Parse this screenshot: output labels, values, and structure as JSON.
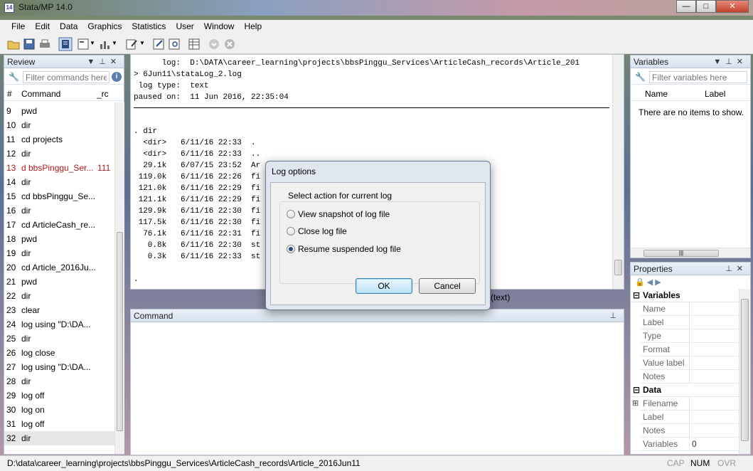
{
  "window": {
    "title": "Stata/MP 14.0",
    "app_icon_text": "14"
  },
  "menu": [
    "File",
    "Edit",
    "Data",
    "Graphics",
    "Statistics",
    "User",
    "Window",
    "Help"
  ],
  "review": {
    "title": "Review",
    "filter_placeholder": "Filter commands here",
    "columns": {
      "num": "#",
      "command": "Command",
      "rc": "_rc"
    },
    "rows": [
      {
        "num": "9",
        "cmd": "pwd",
        "rc": ""
      },
      {
        "num": "10",
        "cmd": "dir",
        "rc": ""
      },
      {
        "num": "11",
        "cmd": "cd projects",
        "rc": ""
      },
      {
        "num": "12",
        "cmd": "dir",
        "rc": ""
      },
      {
        "num": "13",
        "cmd": "d bbsPinggu_Ser...",
        "rc": "111"
      },
      {
        "num": "14",
        "cmd": "dir",
        "rc": ""
      },
      {
        "num": "15",
        "cmd": "cd bbsPinggu_Se...",
        "rc": ""
      },
      {
        "num": "16",
        "cmd": "dir",
        "rc": ""
      },
      {
        "num": "17",
        "cmd": "cd ArticleCash_re...",
        "rc": ""
      },
      {
        "num": "18",
        "cmd": "pwd",
        "rc": ""
      },
      {
        "num": "19",
        "cmd": "dir",
        "rc": ""
      },
      {
        "num": "20",
        "cmd": "cd Article_2016Ju...",
        "rc": ""
      },
      {
        "num": "21",
        "cmd": "pwd",
        "rc": ""
      },
      {
        "num": "22",
        "cmd": "dir",
        "rc": ""
      },
      {
        "num": "23",
        "cmd": "clear",
        "rc": ""
      },
      {
        "num": "24",
        "cmd": "log using \"D:\\DA...",
        "rc": ""
      },
      {
        "num": "25",
        "cmd": "dir",
        "rc": ""
      },
      {
        "num": "26",
        "cmd": "log close",
        "rc": ""
      },
      {
        "num": "27",
        "cmd": "log using \"D:\\DA...",
        "rc": ""
      },
      {
        "num": "28",
        "cmd": "dir",
        "rc": ""
      },
      {
        "num": "29",
        "cmd": "log off",
        "rc": ""
      },
      {
        "num": "30",
        "cmd": "log on",
        "rc": ""
      },
      {
        "num": "31",
        "cmd": "log off",
        "rc": ""
      },
      {
        "num": "32",
        "cmd": "dir",
        "rc": ""
      }
    ]
  },
  "results": {
    "header_lines": [
      "      log:  D:\\DATA\\career_learning\\projects\\bbsPinggu_Services\\ArticleCash_records\\Article_201",
      "> 6Jun11\\stataLog_2.log",
      " log type:  text",
      "paused on:  11 Jun 2016, 22:35:04"
    ],
    "body_lines": [
      ". dir",
      "  <dir>   6/11/16 22:33  .",
      "  <dir>   6/11/16 22:33  ..",
      "  29.1k   6/07/15 23:52  Ar",
      " 119.0k   6/11/16 22:26  fi",
      " 121.0k   6/11/16 22:29  fi",
      " 121.1k   6/11/16 22:29  fi",
      " 129.9k   6/11/16 22:30  fi",
      " 117.5k   6/11/16 22:30  fi",
      "  76.1k   6/11/16 22:31  fi",
      "   0.8k   6/11/16 22:30  st",
      "   0.3k   6/11/16 22:33  st",
      "",
      "."
    ],
    "trailing_text": "(text)"
  },
  "command": {
    "title": "Command"
  },
  "variables": {
    "title": "Variables",
    "filter_placeholder": "Filter variables here",
    "columns": {
      "name": "Name",
      "label": "Label"
    },
    "empty_text": "There are no items to show."
  },
  "properties": {
    "title": "Properties",
    "sections": [
      {
        "name": "Variables",
        "rows": [
          {
            "key": "Name",
            "value": ""
          },
          {
            "key": "Label",
            "value": ""
          },
          {
            "key": "Type",
            "value": ""
          },
          {
            "key": "Format",
            "value": ""
          },
          {
            "key": "Value label",
            "value": ""
          },
          {
            "key": "Notes",
            "value": ""
          }
        ]
      },
      {
        "name": "Data",
        "rows": [
          {
            "key": "Filename",
            "value": ""
          },
          {
            "key": "Label",
            "value": ""
          },
          {
            "key": "Notes",
            "value": ""
          },
          {
            "key": "Variables",
            "value": "0"
          }
        ]
      }
    ]
  },
  "statusbar": {
    "path": "D:\\data\\career_learning\\projects\\bbsPinggu_Services\\ArticleCash_records\\Article_2016Jun11",
    "indicators": [
      "CAP",
      "NUM",
      "OVR"
    ]
  },
  "dialog": {
    "title": "Log options",
    "group_label": "Select action for current log",
    "options": [
      {
        "label": "View snapshot of log file",
        "selected": false
      },
      {
        "label": "Close log file",
        "selected": false
      },
      {
        "label": "Resume suspended log file",
        "selected": true
      }
    ],
    "ok": "OK",
    "cancel": "Cancel"
  },
  "colors": {
    "error_row": "#b01818",
    "panel_border": "#b9c3cf",
    "dialog_default": "#3c7fb1"
  }
}
